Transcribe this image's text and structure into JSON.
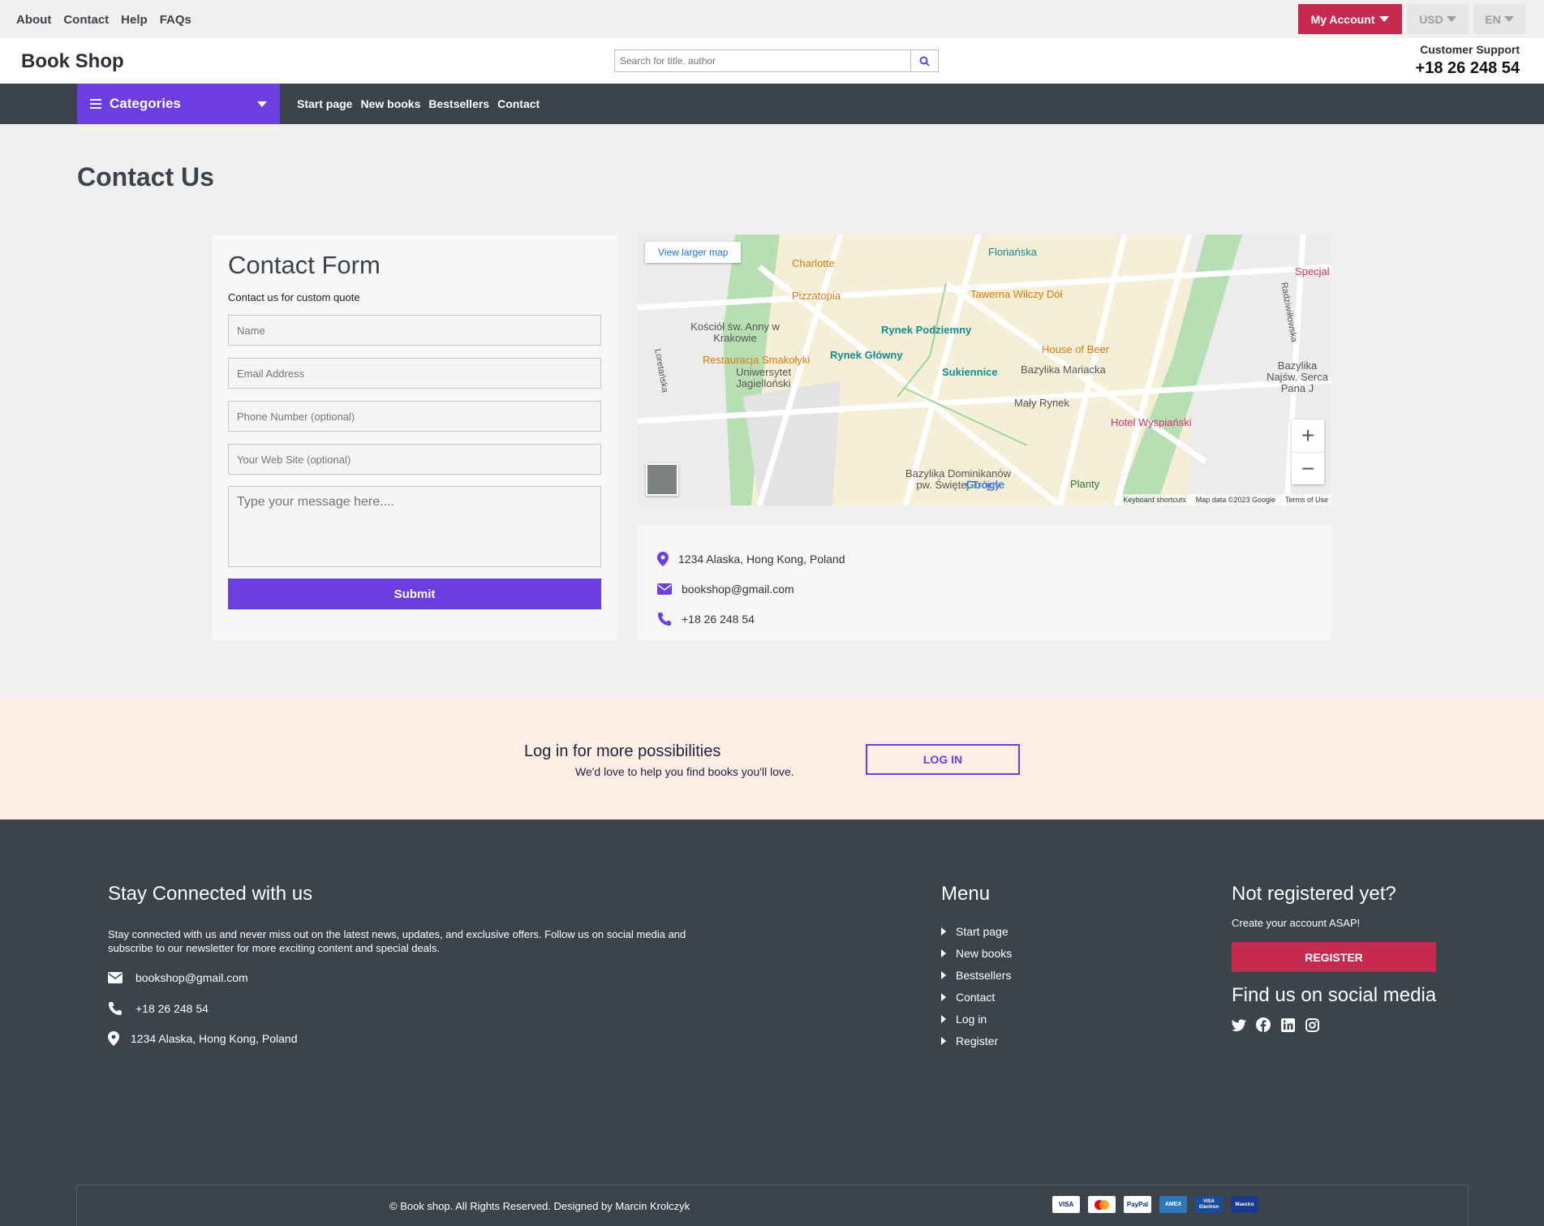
{
  "topbar": {
    "links": [
      "About",
      "Contact",
      "Help",
      "FAQs"
    ],
    "account_label": "My Account",
    "currency": "USD",
    "language": "EN"
  },
  "header": {
    "brand": "Book Shop",
    "search_placeholder": "Search for title, author",
    "support_label": "Customer Support",
    "support_phone": "+18 26 248 54"
  },
  "nav": {
    "categories_label": "Categories",
    "links": [
      "Start page",
      "New books",
      "Bestsellers",
      "Contact"
    ]
  },
  "page": {
    "title": "Contact Us"
  },
  "form": {
    "title": "Contact Form",
    "subtitle": "Contact us for custom quote",
    "name_placeholder": "Name",
    "email_placeholder": "Email Address",
    "phone_placeholder": "Phone Number (optional)",
    "website_placeholder": "Your Web Site (optional)",
    "message_placeholder": "Type your message here....",
    "submit_label": "Submit"
  },
  "map": {
    "larger_map_label": "View larger map",
    "places": [
      "Charlotte",
      "Pizzatopia",
      "Floriańska",
      "Tawerna Wilczy Dół",
      "Kościół św. Anny w Krakowie",
      "Rynek Podziemny",
      "Rynek Główny",
      "Sukiennice",
      "Bazylika Mariacka",
      "House of Beer",
      "Restauracja Smakołyki",
      "Uniwersytet Jagielloński",
      "Mały Rynek",
      "Hotel Wyspiański",
      "Bazylika Najśw. Serca Pana J",
      "Bazylika Dominikanów pw. Świętej Trójcy",
      "Planty",
      "Loretańska",
      "Radziwiłłowska",
      "Specjal"
    ],
    "footer_links": [
      "Keyboard shortcuts",
      "Map data ©2023 Google",
      "Terms of Use"
    ]
  },
  "contact_info": {
    "address": "1234 Alaska, Hong Kong, Poland",
    "email": "bookshop@gmail.com",
    "phone": "+18 26 248 54"
  },
  "login_band": {
    "title": "Log in for more possibilities",
    "subtitle": "We'd love to help you find books you'll love.",
    "button": "LOG IN"
  },
  "footer": {
    "connected_title": "Stay Connected with us",
    "connected_text": "Stay connected with us and never miss out on the latest news, updates, and exclusive offers. Follow us on social media and subscribe to our newsletter for more exciting content and special deals.",
    "email": "bookshop@gmail.com",
    "phone": "+18 26 248 54",
    "address": "1234 Alaska, Hong Kong, Poland",
    "menu_title": "Menu",
    "menu_items": [
      "Start page",
      "New books",
      "Bestsellers",
      "Contact",
      "Log in",
      "Register"
    ],
    "register_title": "Not registered yet?",
    "register_text": "Create your account ASAP!",
    "register_button": "REGISTER",
    "social_title": "Find us on social media",
    "social_icons": [
      "twitter-icon",
      "facebook-icon",
      "linkedin-icon",
      "instagram-icon"
    ],
    "copyright": "© Book shop. All Rights Reserved. Designed by Marcin Krolczyk",
    "payment_cards": [
      "VISA",
      "mastercard",
      "PayPal",
      "AMEX",
      "VISA Electron",
      "Maestro"
    ]
  },
  "colors": {
    "accent_purple": "#6c3ee0",
    "accent_red": "#c62a50",
    "dark": "#3d434b",
    "band": "#ffeee6"
  }
}
